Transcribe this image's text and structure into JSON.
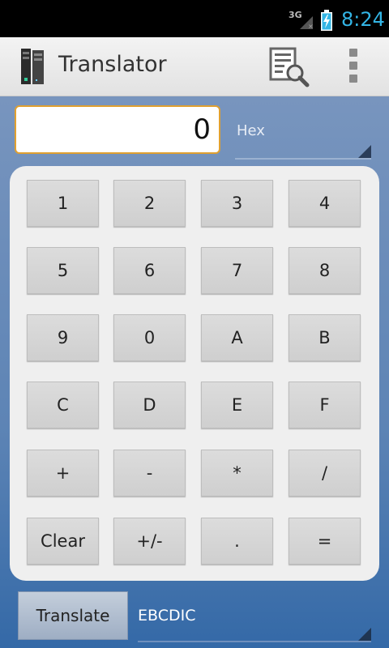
{
  "status_bar": {
    "network": "3G",
    "time": "8:24",
    "time_color": "#33b5e5"
  },
  "action_bar": {
    "title": "Translator",
    "app_icon": "server-tower-icon",
    "actions": [
      "document-search-icon",
      "overflow-menu-icon"
    ]
  },
  "input": {
    "display_value": "0",
    "from_format": "Hex"
  },
  "keypad": {
    "rows": [
      [
        "1",
        "2",
        "3",
        "4"
      ],
      [
        "5",
        "6",
        "7",
        "8"
      ],
      [
        "9",
        "0",
        "A",
        "B"
      ],
      [
        "C",
        "D",
        "E",
        "F"
      ],
      [
        "+",
        "-",
        "*",
        "/"
      ],
      [
        "Clear",
        "+/-",
        ".",
        "="
      ]
    ]
  },
  "bottom": {
    "translate_label": "Translate",
    "to_format": "EBCDIC"
  },
  "colors": {
    "accent": "#33b5e5",
    "display_border": "#e0a030",
    "background_top": "#7895be",
    "background_bottom": "#3469a7"
  }
}
